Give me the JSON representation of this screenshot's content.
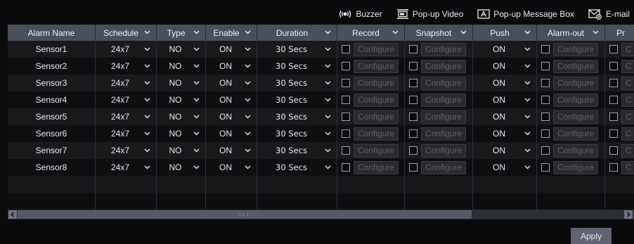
{
  "actions": {
    "buzzer": "Buzzer",
    "popup_video": "Pop-up Video",
    "popup_message_box": "Pop-up Message Box",
    "email": "E-mail"
  },
  "columns": {
    "alarm_name": "Alarm Name",
    "schedule": "Schedule",
    "type": "Type",
    "enable": "Enable",
    "duration": "Duration",
    "record": "Record",
    "snapshot": "Snapshot",
    "push": "Push",
    "alarm_out": "Alarm-out",
    "preset": "Pr"
  },
  "rows": [
    {
      "name": "Sensor1",
      "schedule": "24x7",
      "type": "NO",
      "enable": "ON",
      "duration": "30 Secs",
      "push": "ON",
      "configure": "Configure",
      "preset_cfg": "C"
    },
    {
      "name": "Sensor2",
      "schedule": "24x7",
      "type": "NO",
      "enable": "ON",
      "duration": "30 Secs",
      "push": "ON",
      "configure": "Configure",
      "preset_cfg": "C"
    },
    {
      "name": "Sensor3",
      "schedule": "24x7",
      "type": "NO",
      "enable": "ON",
      "duration": "30 Secs",
      "push": "ON",
      "configure": "Configure",
      "preset_cfg": "C"
    },
    {
      "name": "Sensor4",
      "schedule": "24x7",
      "type": "NO",
      "enable": "ON",
      "duration": "30 Secs",
      "push": "ON",
      "configure": "Configure",
      "preset_cfg": "C"
    },
    {
      "name": "Sensor5",
      "schedule": "24x7",
      "type": "NO",
      "enable": "ON",
      "duration": "30 Secs",
      "push": "ON",
      "configure": "Configure",
      "preset_cfg": "C"
    },
    {
      "name": "Sensor6",
      "schedule": "24x7",
      "type": "NO",
      "enable": "ON",
      "duration": "30 Secs",
      "push": "ON",
      "configure": "Configure",
      "preset_cfg": "C"
    },
    {
      "name": "Sensor7",
      "schedule": "24x7",
      "type": "NO",
      "enable": "ON",
      "duration": "30 Secs",
      "push": "ON",
      "configure": "Configure",
      "preset_cfg": "C"
    },
    {
      "name": "Sensor8",
      "schedule": "24x7",
      "type": "NO",
      "enable": "ON",
      "duration": "30 Secs",
      "push": "ON",
      "configure": "Configure",
      "preset_cfg": "C"
    }
  ],
  "apply_label": "Apply",
  "icons": {
    "buzzer": "buzzer-icon",
    "popup_video": "popup-video-icon",
    "popup_message_box": "popup-message-icon",
    "email": "email-icon",
    "dropdown": "chevron-down-icon",
    "scroll_left": "arrow-left-icon",
    "scroll_right": "arrow-right-icon"
  },
  "colors": {
    "header_bg": "#4a505a",
    "row_odd": "#1a1a1d",
    "row_even": "#0f0f12",
    "button_bg": "#5f6470"
  }
}
